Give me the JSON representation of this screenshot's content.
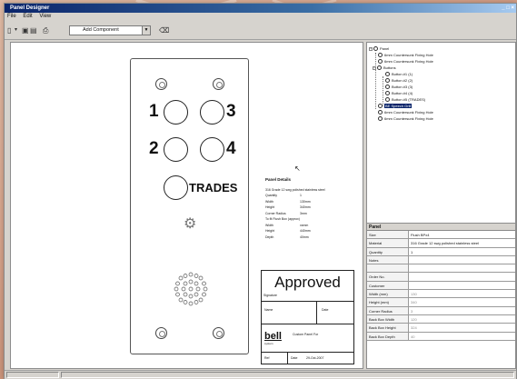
{
  "window": {
    "title": "Panel Designer"
  },
  "menu": [
    "File",
    "Edit",
    "View"
  ],
  "toolbar": {
    "combo_value": "Add Component"
  },
  "panel": {
    "buttons": [
      "1",
      "3",
      "2",
      "4"
    ],
    "trades_label": "TRADES"
  },
  "details": {
    "title": "Panel Details",
    "material_line": "316 Grade 12 swg polished stainless steel",
    "rows": [
      {
        "k": "Quantity",
        "v": "1"
      },
      {
        "k": "Width",
        "v": "130mm"
      },
      {
        "k": "Height",
        "v": "340mm"
      },
      {
        "k": "Corner Radius",
        "v": "3mm"
      }
    ],
    "backbox_title": "To fit Flush Box (approx)",
    "backbox_rows": [
      {
        "k": "Width",
        "v": "xxmm"
      },
      {
        "k": "Height",
        "v": "440mm"
      },
      {
        "k": "Depth",
        "v": "40mm"
      }
    ]
  },
  "approval": {
    "title": "Approved",
    "signature": "Signature",
    "name": "Name",
    "date": "Date",
    "brand": "bell",
    "brand_sub": "system",
    "caption": "Custom Panel For",
    "ref": "Ref",
    "date2_label": "Date",
    "date2_value": "29-Oct-2007"
  },
  "tree": [
    {
      "label": "Panel",
      "level": 0,
      "icon": "panel-icon"
    },
    {
      "label": "6mm Countersunk Fixing Hole",
      "level": 1,
      "icon": "hole-icon"
    },
    {
      "label": "6mm Countersunk Fixing Hole",
      "level": 1,
      "icon": "hole-icon"
    },
    {
      "label": "Buttons",
      "level": 1,
      "icon": "folder-icon"
    },
    {
      "label": "Button #1 (1)",
      "level": 2,
      "icon": "button-icon"
    },
    {
      "label": "Button #2 (2)",
      "level": 2,
      "icon": "button-icon"
    },
    {
      "label": "Button #3 (3)",
      "level": 2,
      "icon": "button-icon"
    },
    {
      "label": "Button #4 (4)",
      "level": 2,
      "icon": "button-icon"
    },
    {
      "label": "Button #5 (TRADES)",
      "level": 2,
      "icon": "button-icon"
    },
    {
      "label": "BE Speech Grill",
      "level": 1,
      "icon": "grill-icon",
      "selected": true
    },
    {
      "label": "6mm Countersunk Fixing Hole",
      "level": 1,
      "icon": "hole-icon"
    },
    {
      "label": "6mm Countersunk Fixing Hole",
      "level": 1,
      "icon": "hole-icon"
    }
  ],
  "properties": {
    "header": "Panel",
    "rows": [
      {
        "k": "Size",
        "v": "Flush BPx4"
      },
      {
        "k": "Material",
        "v": "316 Grade 12 swg polished stainless steel"
      },
      {
        "k": "Quantity",
        "v": "1"
      },
      {
        "k": "Notes",
        "v": ""
      },
      {
        "k": "",
        "v": ""
      },
      {
        "k": "Order No.",
        "v": ""
      },
      {
        "k": "Customer",
        "v": ""
      },
      {
        "k": "Width (mm)",
        "v": "130",
        "dim": true
      },
      {
        "k": "Height (mm)",
        "v": "340",
        "dim": true
      },
      {
        "k": "Corner Radius",
        "v": "3",
        "dim": true
      },
      {
        "k": "Back Box Width",
        "v": "120",
        "dim": true
      },
      {
        "k": "Back Box Height",
        "v": "324",
        "dim": true
      },
      {
        "k": "Back Box Depth",
        "v": "40",
        "dim": true
      }
    ]
  },
  "background": {
    "accent": "#d7a48c",
    "window_frame": "#d6d3ce",
    "titlebar": "#0a246a",
    "selection": "#0a246a"
  }
}
